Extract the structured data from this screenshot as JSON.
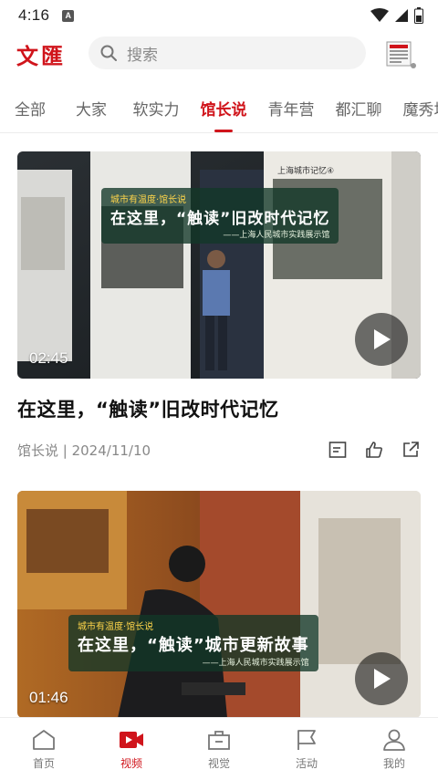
{
  "status_bar": {
    "time": "4:16",
    "badge": "A"
  },
  "header": {
    "logo": "文匯",
    "search_placeholder": "搜索"
  },
  "tabs": [
    {
      "label": "全部",
      "active": false
    },
    {
      "label": "大家",
      "active": false
    },
    {
      "label": "软实力",
      "active": false
    },
    {
      "label": "馆长说",
      "active": true
    },
    {
      "label": "青年营",
      "active": false
    },
    {
      "label": "都汇聊",
      "active": false
    },
    {
      "label": "魔秀场",
      "active": false
    }
  ],
  "feed": [
    {
      "duration": "02:45",
      "title": "在这里，“触读”旧改时代记忆",
      "meta": "馆长说 | 2024/11/10",
      "overlay": {
        "tag": "城市有温度·馆长说",
        "title": "在这里，“触读”旧改时代记忆",
        "subtitle": "——上海人民城市实践展示馆"
      },
      "board_caption": "上海城市记忆④"
    },
    {
      "duration": "01:46",
      "title": "在这里，“触读”城市更新故事",
      "meta": "",
      "overlay": {
        "tag": "城市有温度·馆长说",
        "title": "在这里，“触读”城市更新故事",
        "subtitle": "——上海人民城市实践展示馆"
      }
    }
  ],
  "bottom_nav": [
    {
      "label": "首页",
      "icon": "home-icon",
      "active": false
    },
    {
      "label": "视频",
      "icon": "video-icon",
      "active": true
    },
    {
      "label": "视觉",
      "icon": "briefcase-icon",
      "active": false
    },
    {
      "label": "活动",
      "icon": "flag-icon",
      "active": false
    },
    {
      "label": "我的",
      "icon": "user-icon",
      "active": false
    }
  ],
  "colors": {
    "brand": "#d0141b",
    "muted": "#888888"
  }
}
